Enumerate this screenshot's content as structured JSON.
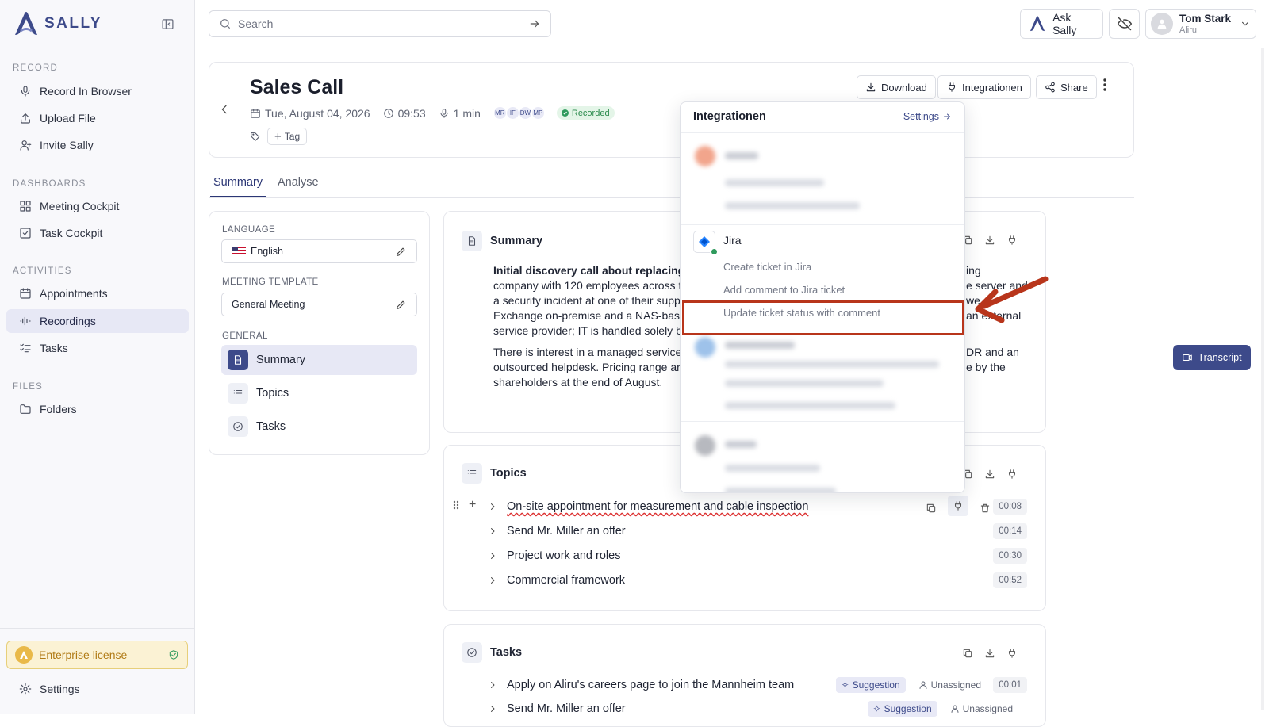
{
  "app": {
    "name": "SALLY"
  },
  "sidebar": {
    "sections": [
      {
        "label": "RECORD",
        "items": [
          {
            "label": "Record In Browser",
            "icon": "mic-icon"
          },
          {
            "label": "Upload File",
            "icon": "upload-icon"
          },
          {
            "label": "Invite Sally",
            "icon": "user-plus-icon"
          }
        ]
      },
      {
        "label": "DASHBOARDS",
        "items": [
          {
            "label": "Meeting Cockpit",
            "icon": "grid-icon"
          },
          {
            "label": "Task Cockpit",
            "icon": "check-square-icon"
          }
        ]
      },
      {
        "label": "ACTIVITIES",
        "items": [
          {
            "label": "Appointments",
            "icon": "calendar-icon"
          },
          {
            "label": "Recordings",
            "icon": "waveform-icon",
            "active": true
          },
          {
            "label": "Tasks",
            "icon": "list-check-icon"
          }
        ]
      },
      {
        "label": "FILES",
        "items": [
          {
            "label": "Folders",
            "icon": "folder-icon"
          }
        ]
      }
    ],
    "license": "Enterprise license",
    "settings": "Settings"
  },
  "topbar": {
    "search_placeholder": "Search",
    "ask_label": "Ask Sally",
    "user": {
      "name": "Tom Stark",
      "org": "Aliru"
    }
  },
  "meeting": {
    "title": "Sales Call",
    "date": "Tue, August 04, 2026",
    "time": "09:53",
    "duration": "1 min",
    "participants": [
      "MR",
      "IF",
      "DW",
      "MP"
    ],
    "status": "Recorded",
    "tag_label": "Tag",
    "actions": {
      "download": "Download",
      "integrations": "Integrationen",
      "share": "Share"
    }
  },
  "tabs": [
    {
      "label": "Summary",
      "active": true
    },
    {
      "label": "Analyse"
    }
  ],
  "settings_panel": {
    "language_label": "LANGUAGE",
    "language": "English",
    "template_label": "MEETING TEMPLATE",
    "template": "General Meeting",
    "general_label": "GENERAL",
    "nav": [
      {
        "label": "Summary",
        "active": true
      },
      {
        "label": "Topics"
      },
      {
        "label": "Tasks"
      }
    ]
  },
  "summary": {
    "heading": "Summary",
    "para1_left": "Initial discovery call about replacing t",
    "para1_lines_left": [
      "company with 120 employees across t",
      "a security incident at one of their supp",
      "Exchange on-premise and a NAS-base",
      "service provider; IT is handled solely b"
    ],
    "para1_right": [
      "ing",
      "e server and",
      "we",
      "an external",
      ""
    ],
    "para2_left": [
      "There is interest in a managed service",
      "outsourced helpdesk. Pricing range ar",
      "shareholders at the end of August."
    ],
    "para2_right": [
      "DR and an",
      "e by the",
      ""
    ]
  },
  "topics": {
    "heading": "Topics",
    "items": [
      {
        "label": "On-site appointment for measurement and cable inspection",
        "time": "00:08"
      },
      {
        "label": "Send Mr. Miller an offer",
        "time": "00:14"
      },
      {
        "label": "Project work and roles",
        "time": "00:30"
      },
      {
        "label": "Commercial framework",
        "time": "00:52"
      }
    ]
  },
  "tasks": {
    "heading": "Tasks",
    "items": [
      {
        "label": "Apply on Aliru's careers page to join the Mannheim team",
        "badge": "Suggestion",
        "assignee": "Unassigned",
        "time": "00:01"
      },
      {
        "label": "Send Mr. Miller an offer",
        "badge": "Suggestion",
        "assignee": "Unassigned",
        "time": ""
      }
    ]
  },
  "integrations_popover": {
    "title": "Integrationen",
    "settings_link": "Settings",
    "jira": {
      "name": "Jira",
      "options": [
        "Create ticket in Jira",
        "Add comment to Jira ticket",
        "Update ticket status with comment"
      ]
    },
    "highlight_color": "#b8351b"
  },
  "transcript_button": "Transcript",
  "colors": {
    "brand": "#3d4a8a",
    "active_bg": "#e7e8f5",
    "license_bg": "#fbf2d4",
    "success": "#2f9a5d"
  }
}
